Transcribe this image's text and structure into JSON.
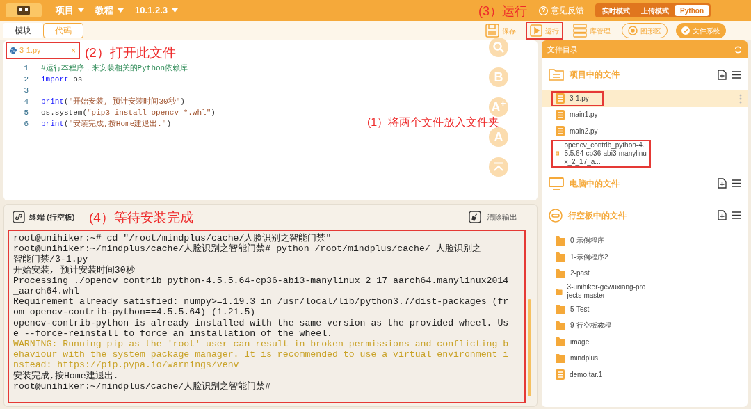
{
  "topbar": {
    "menus": [
      {
        "label": "项目"
      },
      {
        "label": "教程"
      },
      {
        "label": "10.1.2.3"
      }
    ],
    "feedback": "意见反馈",
    "modes": [
      {
        "label": "实时模式",
        "selected": false
      },
      {
        "label": "上传模式",
        "selected": false
      },
      {
        "label": "Python",
        "selected": true
      }
    ]
  },
  "view_tabs": [
    {
      "label": "模块",
      "selected": false
    },
    {
      "label": "代码",
      "selected": true
    }
  ],
  "toolbar": [
    {
      "kind": "save",
      "label": "保存",
      "marked": false
    },
    {
      "kind": "run",
      "label": "运行",
      "marked": true
    },
    {
      "kind": "library",
      "label": "库管理",
      "marked": false
    },
    {
      "kind": "graphics",
      "label": "图形区",
      "marked": false
    },
    {
      "kind": "files",
      "label": "文件系统",
      "marked": false
    }
  ],
  "editor": {
    "tab": {
      "label": "3-1.py",
      "close": "×",
      "marked": true
    },
    "lines": [
      {
        "number": "1",
        "tokens": [
          {
            "text": "#运行本程序，来安装相关的Python依赖库",
            "kind": "comment"
          }
        ]
      },
      {
        "number": "2",
        "tokens": [
          {
            "text": "import",
            "kind": "keyword"
          },
          {
            "text": " os",
            "kind": "plain"
          }
        ]
      },
      {
        "number": "3"
      },
      {
        "number": "4",
        "tokens": [
          {
            "text": "print",
            "kind": "keyword"
          },
          {
            "text": "(",
            "kind": "plain"
          },
          {
            "text": "\"开始安装, 预计安装时间30秒\"",
            "kind": "string"
          },
          {
            "text": ")",
            "kind": "plain"
          }
        ]
      },
      {
        "number": "5",
        "tokens": [
          {
            "text": "os.system(",
            "kind": "plain"
          },
          {
            "text": "\"pip3 install opencv_*.whl\"",
            "kind": "string"
          },
          {
            "text": ")",
            "kind": "plain"
          }
        ]
      },
      {
        "number": "6",
        "tokens": [
          {
            "text": "print",
            "kind": "keyword"
          },
          {
            "text": "(",
            "kind": "plain"
          },
          {
            "text": "\"安装完成,按Home建退出.\"",
            "kind": "string"
          },
          {
            "text": ")",
            "kind": "plain"
          }
        ]
      }
    ],
    "side_tools": [
      {
        "kind": "search"
      },
      {
        "kind": "letter",
        "text": "B"
      },
      {
        "kind": "letter",
        "text": "A$^{+}$"
      },
      {
        "kind": "letter",
        "text": "A"
      },
      {
        "kind": "collapse"
      }
    ]
  },
  "terminal": {
    "title": "终端 (行空板)",
    "clear": "清除输出",
    "marked": true,
    "lines": [
      {
        "text": "root@unihiker:~# cd \"/root/mindplus/cache/人脸识别之智能门禁\"",
        "kind": "output"
      },
      {
        "text": "root@unihiker:~/mindplus/cache/人脸识别之智能门禁# python /root/mindplus/cache/ 人脸识别之",
        "kind": "output"
      },
      {
        "text": "智能门禁/3-1.py",
        "kind": "output"
      },
      {
        "text": "开始安装, 预计安装时间30秒",
        "kind": "output"
      },
      {
        "text": "Processing ./opencv_contrib_python-4.5.5.64-cp36-abi3-manylinux_2_17_aarch64.manylinux2014",
        "kind": "output"
      },
      {
        "text": "_aarch64.whl",
        "kind": "output"
      },
      {
        "text": "Requirement already satisfied: numpy>=1.19.3 in /usr/local/lib/python3.7/dist-packages (fr",
        "kind": "output"
      },
      {
        "text": "om opencv-contrib-python==4.5.5.64) (1.21.5)",
        "kind": "output"
      },
      {
        "text": "opencv-contrib-python is already installed with the same version as the provided wheel. Us",
        "kind": "output"
      },
      {
        "text": "e --force-reinstall to force an installation of the wheel.",
        "kind": "output"
      },
      {
        "text": "WARNING: Running pip as the 'root' user can result in broken permissions and conflicting b",
        "kind": "warning"
      },
      {
        "text": "ehaviour with the system package manager. It is recommended to use a virtual environment i",
        "kind": "warning"
      },
      {
        "text": "nstead: https://pip.pypa.io/warnings/venv",
        "kind": "warning"
      },
      {
        "text": "安装完成,按Home建退出.",
        "kind": "output"
      },
      {
        "text": "root@unihiker:~/mindplus/cache/人脸识别之智能门禁# _",
        "kind": "output"
      }
    ]
  },
  "files": {
    "title": "文件目录",
    "sections": [
      {
        "title": "项目中的文件",
        "kind": "project",
        "items": [
          {
            "name": "3-1.py",
            "kind": "file",
            "selected": true,
            "marked": true
          },
          {
            "name": "main1.py",
            "kind": "file",
            "selected": false,
            "marked": false
          },
          {
            "name": "main2.py",
            "kind": "file",
            "selected": false,
            "marked": false
          },
          {
            "name": "opencv_contrib_python-4.5.5.64-cp36-abi3-manylinux_2_17_a...",
            "kind": "file",
            "selected": false,
            "marked": true
          }
        ]
      },
      {
        "title": "电脑中的文件",
        "kind": "computer"
      },
      {
        "title": "行空板中的文件",
        "kind": "board",
        "items": [
          {
            "name": "0-示例程序",
            "kind": "folder",
            "selected": false,
            "marked": false
          },
          {
            "name": "1-示例程序2",
            "kind": "folder",
            "selected": false,
            "marked": false
          },
          {
            "name": "2-past",
            "kind": "folder",
            "selected": false,
            "marked": false
          },
          {
            "name": "3-unihiker-gewuxiang-projects-master",
            "kind": "folder",
            "selected": false,
            "marked": false
          },
          {
            "name": "5-Test",
            "kind": "folder",
            "selected": false,
            "marked": false
          },
          {
            "name": "9-行空板教程",
            "kind": "folder",
            "selected": false,
            "marked": false
          },
          {
            "name": "image",
            "kind": "folder",
            "selected": false,
            "marked": false
          },
          {
            "name": "mindplus",
            "kind": "folder",
            "selected": false,
            "marked": false
          },
          {
            "name": "demo.tar.1",
            "kind": "file",
            "selected": false,
            "marked": false
          }
        ]
      }
    ]
  },
  "annotations": [
    {
      "text": "(3）运行"
    },
    {
      "text": "(2）打开此文件"
    },
    {
      "text": "(1）将两个文件放入文件夹"
    },
    {
      "text": "(4）等待安装完成"
    }
  ]
}
